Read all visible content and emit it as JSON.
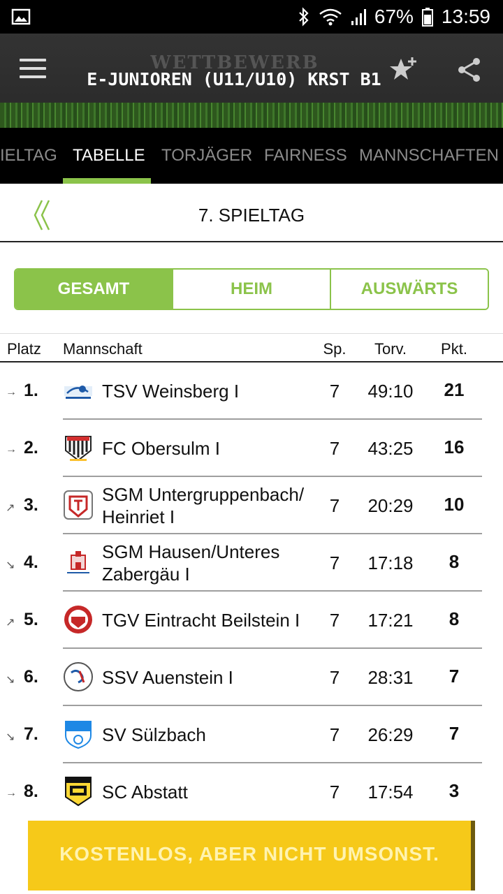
{
  "status_bar": {
    "battery": "67%",
    "time": "13:59"
  },
  "app_bar": {
    "overline": "WETTBEWERB",
    "title": "E-JUNIOREN (U11/U10) KRST B1"
  },
  "tabs": [
    {
      "label": "IELTAG",
      "active": false
    },
    {
      "label": "TABELLE",
      "active": true
    },
    {
      "label": "TORJÄGER",
      "active": false
    },
    {
      "label": "FAIRNESS",
      "active": false
    },
    {
      "label": "MANNSCHAFTEN",
      "active": false
    }
  ],
  "matchday": {
    "label": "7. SPIELTAG"
  },
  "filter": {
    "options": [
      "GESAMT",
      "HEIM",
      "AUSWÄRTS"
    ],
    "selected": "GESAMT"
  },
  "table": {
    "headers": {
      "platz": "Platz",
      "mannschaft": "Mannschaft",
      "sp": "Sp.",
      "torv": "Torv.",
      "pkt": "Pkt."
    },
    "rows": [
      {
        "trend": "→",
        "rank": "1.",
        "team": "TSV Weinsberg I",
        "sp": "7",
        "torv": "49:10",
        "pkt": "21"
      },
      {
        "trend": "→",
        "rank": "2.",
        "team": "FC Obersulm I",
        "sp": "7",
        "torv": "43:25",
        "pkt": "16"
      },
      {
        "trend": "↗",
        "rank": "3.",
        "team": "SGM Untergruppenbach/ Heinriet I",
        "sp": "7",
        "torv": "20:29",
        "pkt": "10"
      },
      {
        "trend": "↘",
        "rank": "4.",
        "team": "SGM Hausen/Unteres Zabergäu I",
        "sp": "7",
        "torv": "17:18",
        "pkt": "8"
      },
      {
        "trend": "↗",
        "rank": "5.",
        "team": "TGV Eintracht Beilstein I",
        "sp": "7",
        "torv": "17:21",
        "pkt": "8"
      },
      {
        "trend": "↘",
        "rank": "6.",
        "team": "SSV Auenstein I",
        "sp": "7",
        "torv": "28:31",
        "pkt": "7"
      },
      {
        "trend": "↘",
        "rank": "7.",
        "team": "SV Sülzbach",
        "sp": "7",
        "torv": "26:29",
        "pkt": "7"
      },
      {
        "trend": "→",
        "rank": "8.",
        "team": "SC Abstatt",
        "sp": "7",
        "torv": "17:54",
        "pkt": "3"
      }
    ]
  },
  "banner": {
    "text": "KOSTENLOS, ABER NICHT UMSONST."
  },
  "colors": {
    "accent": "#8bc34a",
    "banner": "#f6c919"
  }
}
